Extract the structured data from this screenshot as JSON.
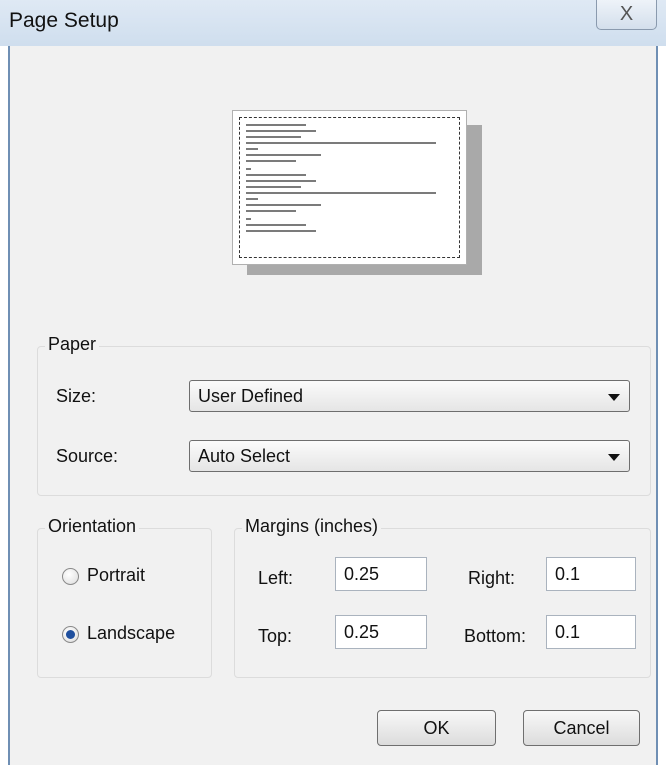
{
  "window": {
    "title": "Page Setup",
    "close_glyph": "X"
  },
  "preview": {
    "icon": "page-preview"
  },
  "paper": {
    "legend": "Paper",
    "size_label": "Size:",
    "size_value": "User Defined",
    "source_label": "Source:",
    "source_value": "Auto Select"
  },
  "orientation": {
    "legend": "Orientation",
    "portrait_label": "Portrait",
    "landscape_label": "Landscape",
    "selected": "Landscape"
  },
  "margins": {
    "legend": "Margins (inches)",
    "left_label": "Left:",
    "left_value": "0.25",
    "right_label": "Right:",
    "right_value": "0.1",
    "top_label": "Top:",
    "top_value": "0.25",
    "bottom_label": "Bottom:",
    "bottom_value": "0.1"
  },
  "buttons": {
    "ok_label": "OK",
    "cancel_label": "Cancel"
  }
}
